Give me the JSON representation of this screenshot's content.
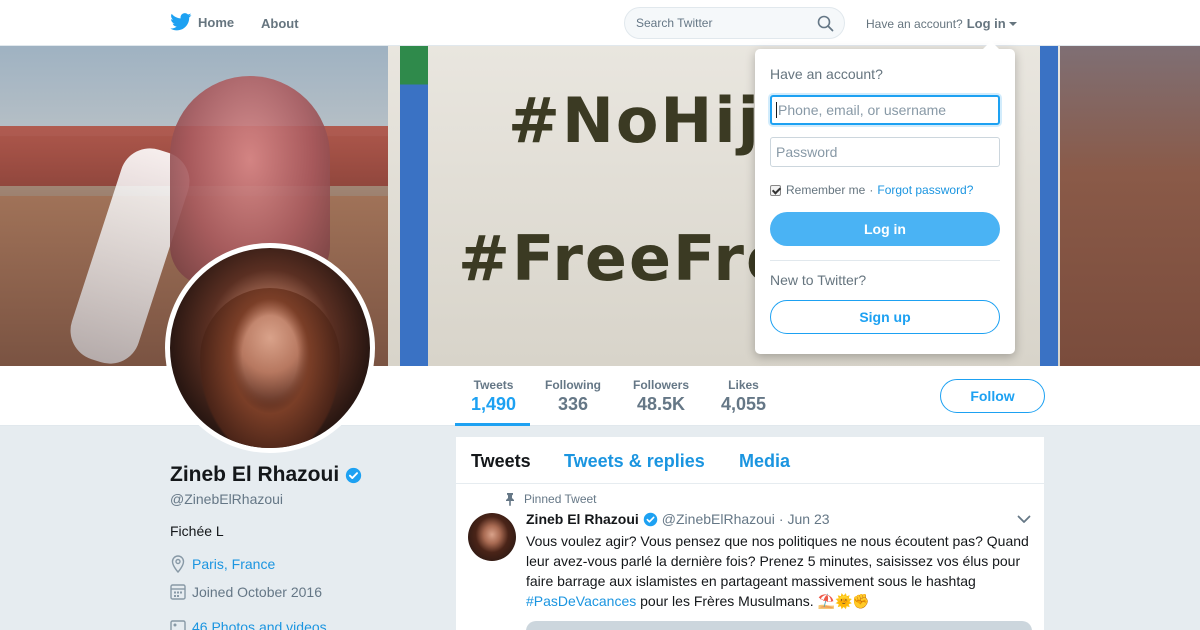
{
  "topnav": {
    "home_label": "Home",
    "about_label": "About",
    "search_placeholder": "Search Twitter",
    "have_account": "Have an account?",
    "login_label": "Log in"
  },
  "banner": {
    "sign_line_1": "#NoHija",
    "sign_line_2": "#FreeFro"
  },
  "profile": {
    "name": "Zineb El Rhazoui",
    "handle": "@ZinebElRhazoui",
    "bio": "Fichée L",
    "location": "Paris, France",
    "joined": "Joined October 2016",
    "photos": "46 Photos and videos",
    "verified": true
  },
  "stats": [
    {
      "label": "Tweets",
      "value": "1,490",
      "active": true
    },
    {
      "label": "Following",
      "value": "336"
    },
    {
      "label": "Followers",
      "value": "48.5K"
    },
    {
      "label": "Likes",
      "value": "4,055"
    }
  ],
  "follow_label": "Follow",
  "timeline": {
    "tabs": [
      "Tweets",
      "Tweets & replies",
      "Media"
    ],
    "pinned_label": "Pinned Tweet",
    "tweet": {
      "name": "Zineb El Rhazoui",
      "handle": "@ZinebElRhazoui",
      "sep": "·",
      "date": "Jun 23",
      "text_before": "Vous voulez agir? Vous pensez que nos politiques ne nous écoutent pas? Quand leur avez-vous parlé la dernière fois? Prenez 5 minutes, saisissez vos élus pour faire barrage aux islamistes en partageant massivement sous le hashtag ",
      "hashtag": "#PasDeVacances",
      "text_after": " pour les Frères Musulmans. ⛱️🌞✊"
    }
  },
  "login_dropdown": {
    "title": "Have an account?",
    "username_placeholder": "Phone, email, or username",
    "password_placeholder": "Password",
    "remember_me": "Remember me",
    "dot": "·",
    "forgot": "Forgot password?",
    "login_button": "Log in",
    "new_to_twitter": "New to Twitter?",
    "signup_button": "Sign up"
  },
  "colors": {
    "accent": "#1da1f2",
    "link": "#1b95e0",
    "login_button": "#4ab3f4",
    "background": "#e6ecf0"
  },
  "icons": [
    "twitter-bird-icon",
    "search-icon",
    "verified-icon",
    "location-icon",
    "calendar-icon",
    "photo-icon",
    "pin-icon",
    "chevron-down-icon"
  ]
}
